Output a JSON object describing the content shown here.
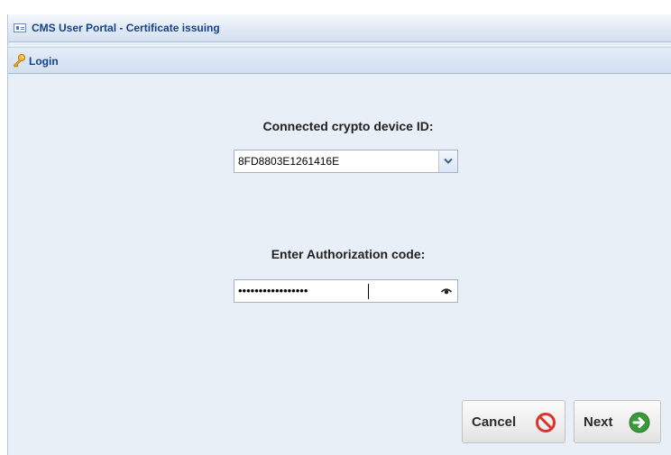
{
  "window": {
    "title": "CMS User Portal - Certificate issuing"
  },
  "panel": {
    "header": "Login",
    "header_icon": "key-icon"
  },
  "form": {
    "device_label": "Connected crypto device ID:",
    "device_value": "8FD8803E1261416E",
    "auth_label": "Enter Authorization code:",
    "auth_masked_value": "•••••••••••••••••"
  },
  "buttons": {
    "cancel_label": "Cancel",
    "cancel_icon": "no-entry-icon",
    "next_label": "Next",
    "next_icon": "arrow-right-circle-icon"
  },
  "colors": {
    "title_text": "#15428b",
    "panel_background": "#e8eff7",
    "cancel_icon": "#d9332b",
    "next_icon": "#3a9a3a"
  }
}
